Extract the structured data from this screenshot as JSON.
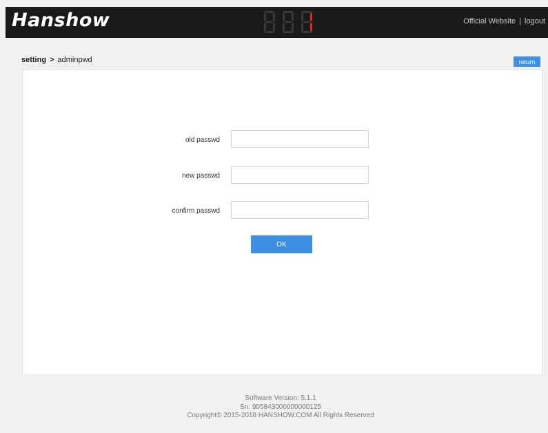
{
  "header": {
    "logo_text": "Hanshow",
    "display_digits": [
      {
        "value": "8",
        "lit": false
      },
      {
        "value": "8",
        "lit": false
      },
      {
        "value": "1",
        "lit": true
      }
    ],
    "links": {
      "official_website": "Official Website",
      "separator": "|",
      "logout": "logout"
    },
    "colors": {
      "bar": "#1a1a1a",
      "digit_lit": "#e8262a",
      "digit_dim": "#3a3a3a"
    }
  },
  "breadcrumb": {
    "parent": "setting",
    "separator": ">",
    "current": "adminpwd"
  },
  "return_button": {
    "label": "return"
  },
  "form": {
    "old_password": {
      "label": "old passwd",
      "value": "",
      "placeholder": ""
    },
    "new_password": {
      "label": "new passwd",
      "value": "",
      "placeholder": ""
    },
    "confirm_password": {
      "label": "confirm passwd",
      "value": "",
      "placeholder": ""
    },
    "submit_label": "OK"
  },
  "footer": {
    "version": "Software Version: 5.1.1",
    "serial": "Sn: 905843000000000125",
    "copyright": "Copyright© 2015-2018 HANSHOW.COM All Rights Reserved"
  },
  "colors": {
    "accent": "#3d8fe0",
    "background": "#f1f1f1",
    "panel": "#ffffff"
  }
}
